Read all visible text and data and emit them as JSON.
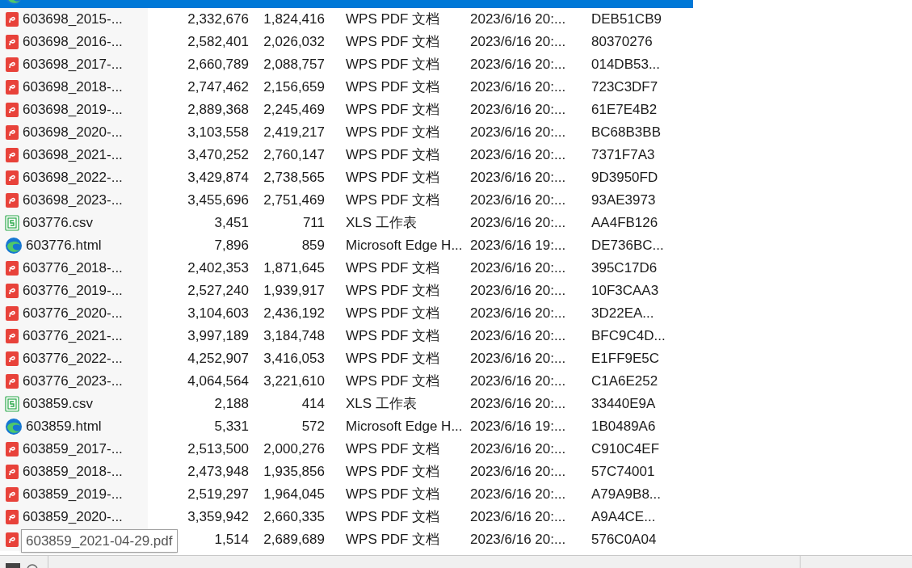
{
  "files": [
    {
      "kind": "html",
      "selected": true
    },
    {
      "kind": "pdf",
      "name": "603698_2015-...",
      "size": "2,332,676",
      "packed": "1,824,416",
      "type": "WPS PDF 文档",
      "modified": "2023/6/16 20:...",
      "crc": "DEB51CB9",
      "selected": false
    },
    {
      "kind": "pdf",
      "name": "603698_2016-...",
      "size": "2,582,401",
      "packed": "2,026,032",
      "type": "WPS PDF 文档",
      "modified": "2023/6/16 20:...",
      "crc": "80370276",
      "selected": false
    },
    {
      "kind": "pdf",
      "name": "603698_2017-...",
      "size": "2,660,789",
      "packed": "2,088,757",
      "type": "WPS PDF 文档",
      "modified": "2023/6/16 20:...",
      "crc": "014DB53...",
      "selected": false
    },
    {
      "kind": "pdf",
      "name": "603698_2018-...",
      "size": "2,747,462",
      "packed": "2,156,659",
      "type": "WPS PDF 文档",
      "modified": "2023/6/16 20:...",
      "crc": "723C3DF7",
      "selected": false
    },
    {
      "kind": "pdf",
      "name": "603698_2019-...",
      "size": "2,889,368",
      "packed": "2,245,469",
      "type": "WPS PDF 文档",
      "modified": "2023/6/16 20:...",
      "crc": "61E7E4B2",
      "selected": false
    },
    {
      "kind": "pdf",
      "name": "603698_2020-...",
      "size": "3,103,558",
      "packed": "2,419,217",
      "type": "WPS PDF 文档",
      "modified": "2023/6/16 20:...",
      "crc": "BC68B3BB",
      "selected": false
    },
    {
      "kind": "pdf",
      "name": "603698_2021-...",
      "size": "3,470,252",
      "packed": "2,760,147",
      "type": "WPS PDF 文档",
      "modified": "2023/6/16 20:...",
      "crc": "7371F7A3",
      "selected": false
    },
    {
      "kind": "pdf",
      "name": "603698_2022-...",
      "size": "3,429,874",
      "packed": "2,738,565",
      "type": "WPS PDF 文档",
      "modified": "2023/6/16 20:...",
      "crc": "9D3950FD",
      "selected": false
    },
    {
      "kind": "pdf",
      "name": "603698_2023-...",
      "size": "3,455,696",
      "packed": "2,751,469",
      "type": "WPS PDF 文档",
      "modified": "2023/6/16 20:...",
      "crc": "93AE3973",
      "selected": false
    },
    {
      "kind": "csv",
      "name": "603776.csv",
      "size": "3,451",
      "packed": "711",
      "type": "XLS 工作表",
      "modified": "2023/6/16 20:...",
      "crc": "AA4FB126",
      "selected": false
    },
    {
      "kind": "html",
      "name": "603776.html",
      "size": "7,896",
      "packed": "859",
      "type": "Microsoft Edge H...",
      "modified": "2023/6/16 19:...",
      "crc": "DE736BC...",
      "selected": false
    },
    {
      "kind": "pdf",
      "name": "603776_2018-...",
      "size": "2,402,353",
      "packed": "1,871,645",
      "type": "WPS PDF 文档",
      "modified": "2023/6/16 20:...",
      "crc": "395C17D6",
      "selected": false
    },
    {
      "kind": "pdf",
      "name": "603776_2019-...",
      "size": "2,527,240",
      "packed": "1,939,917",
      "type": "WPS PDF 文档",
      "modified": "2023/6/16 20:...",
      "crc": "10F3CAA3",
      "selected": false
    },
    {
      "kind": "pdf",
      "name": "603776_2020-...",
      "size": "3,104,603",
      "packed": "2,436,192",
      "type": "WPS PDF 文档",
      "modified": "2023/6/16 20:...",
      "crc": "3D22EA...",
      "selected": false
    },
    {
      "kind": "pdf",
      "name": "603776_2021-...",
      "size": "3,997,189",
      "packed": "3,184,748",
      "type": "WPS PDF 文档",
      "modified": "2023/6/16 20:...",
      "crc": "BFC9C4D...",
      "selected": false
    },
    {
      "kind": "pdf",
      "name": "603776_2022-...",
      "size": "4,252,907",
      "packed": "3,416,053",
      "type": "WPS PDF 文档",
      "modified": "2023/6/16 20:...",
      "crc": "E1FF9E5C",
      "selected": false
    },
    {
      "kind": "pdf",
      "name": "603776_2023-...",
      "size": "4,064,564",
      "packed": "3,221,610",
      "type": "WPS PDF 文档",
      "modified": "2023/6/16 20:...",
      "crc": "C1A6E252",
      "selected": false
    },
    {
      "kind": "csv",
      "name": "603859.csv",
      "size": "2,188",
      "packed": "414",
      "type": "XLS 工作表",
      "modified": "2023/6/16 20:...",
      "crc": "33440E9A",
      "selected": false
    },
    {
      "kind": "html",
      "name": "603859.html",
      "size": "5,331",
      "packed": "572",
      "type": "Microsoft Edge H...",
      "modified": "2023/6/16 19:...",
      "crc": "1B0489A6",
      "selected": false
    },
    {
      "kind": "pdf",
      "name": "603859_2017-...",
      "size": "2,513,500",
      "packed": "2,000,276",
      "type": "WPS PDF 文档",
      "modified": "2023/6/16 20:...",
      "crc": "C910C4EF",
      "selected": false
    },
    {
      "kind": "pdf",
      "name": "603859_2018-...",
      "size": "2,473,948",
      "packed": "1,935,856",
      "type": "WPS PDF 文档",
      "modified": "2023/6/16 20:...",
      "crc": "57C74001",
      "selected": false
    },
    {
      "kind": "pdf",
      "name": "603859_2019-...",
      "size": "2,519,297",
      "packed": "1,964,045",
      "type": "WPS PDF 文档",
      "modified": "2023/6/16 20:...",
      "crc": "A79A9B8...",
      "selected": false
    },
    {
      "kind": "pdf",
      "name": "603859_2020-...",
      "size": "3,359,942",
      "packed": "2,660,335",
      "type": "WPS PDF 文档",
      "modified": "2023/6/16 20:...",
      "crc": "A9A4CE...",
      "selected": false
    },
    {
      "kind": "pdf",
      "size": "1,514",
      "packed": "2,689,689",
      "type": "WPS PDF 文档",
      "modified": "2023/6/16 20:...",
      "crc": "576C0A04",
      "selected": false
    }
  ],
  "tooltip": {
    "text": "603859_2021-04-29.pdf"
  }
}
